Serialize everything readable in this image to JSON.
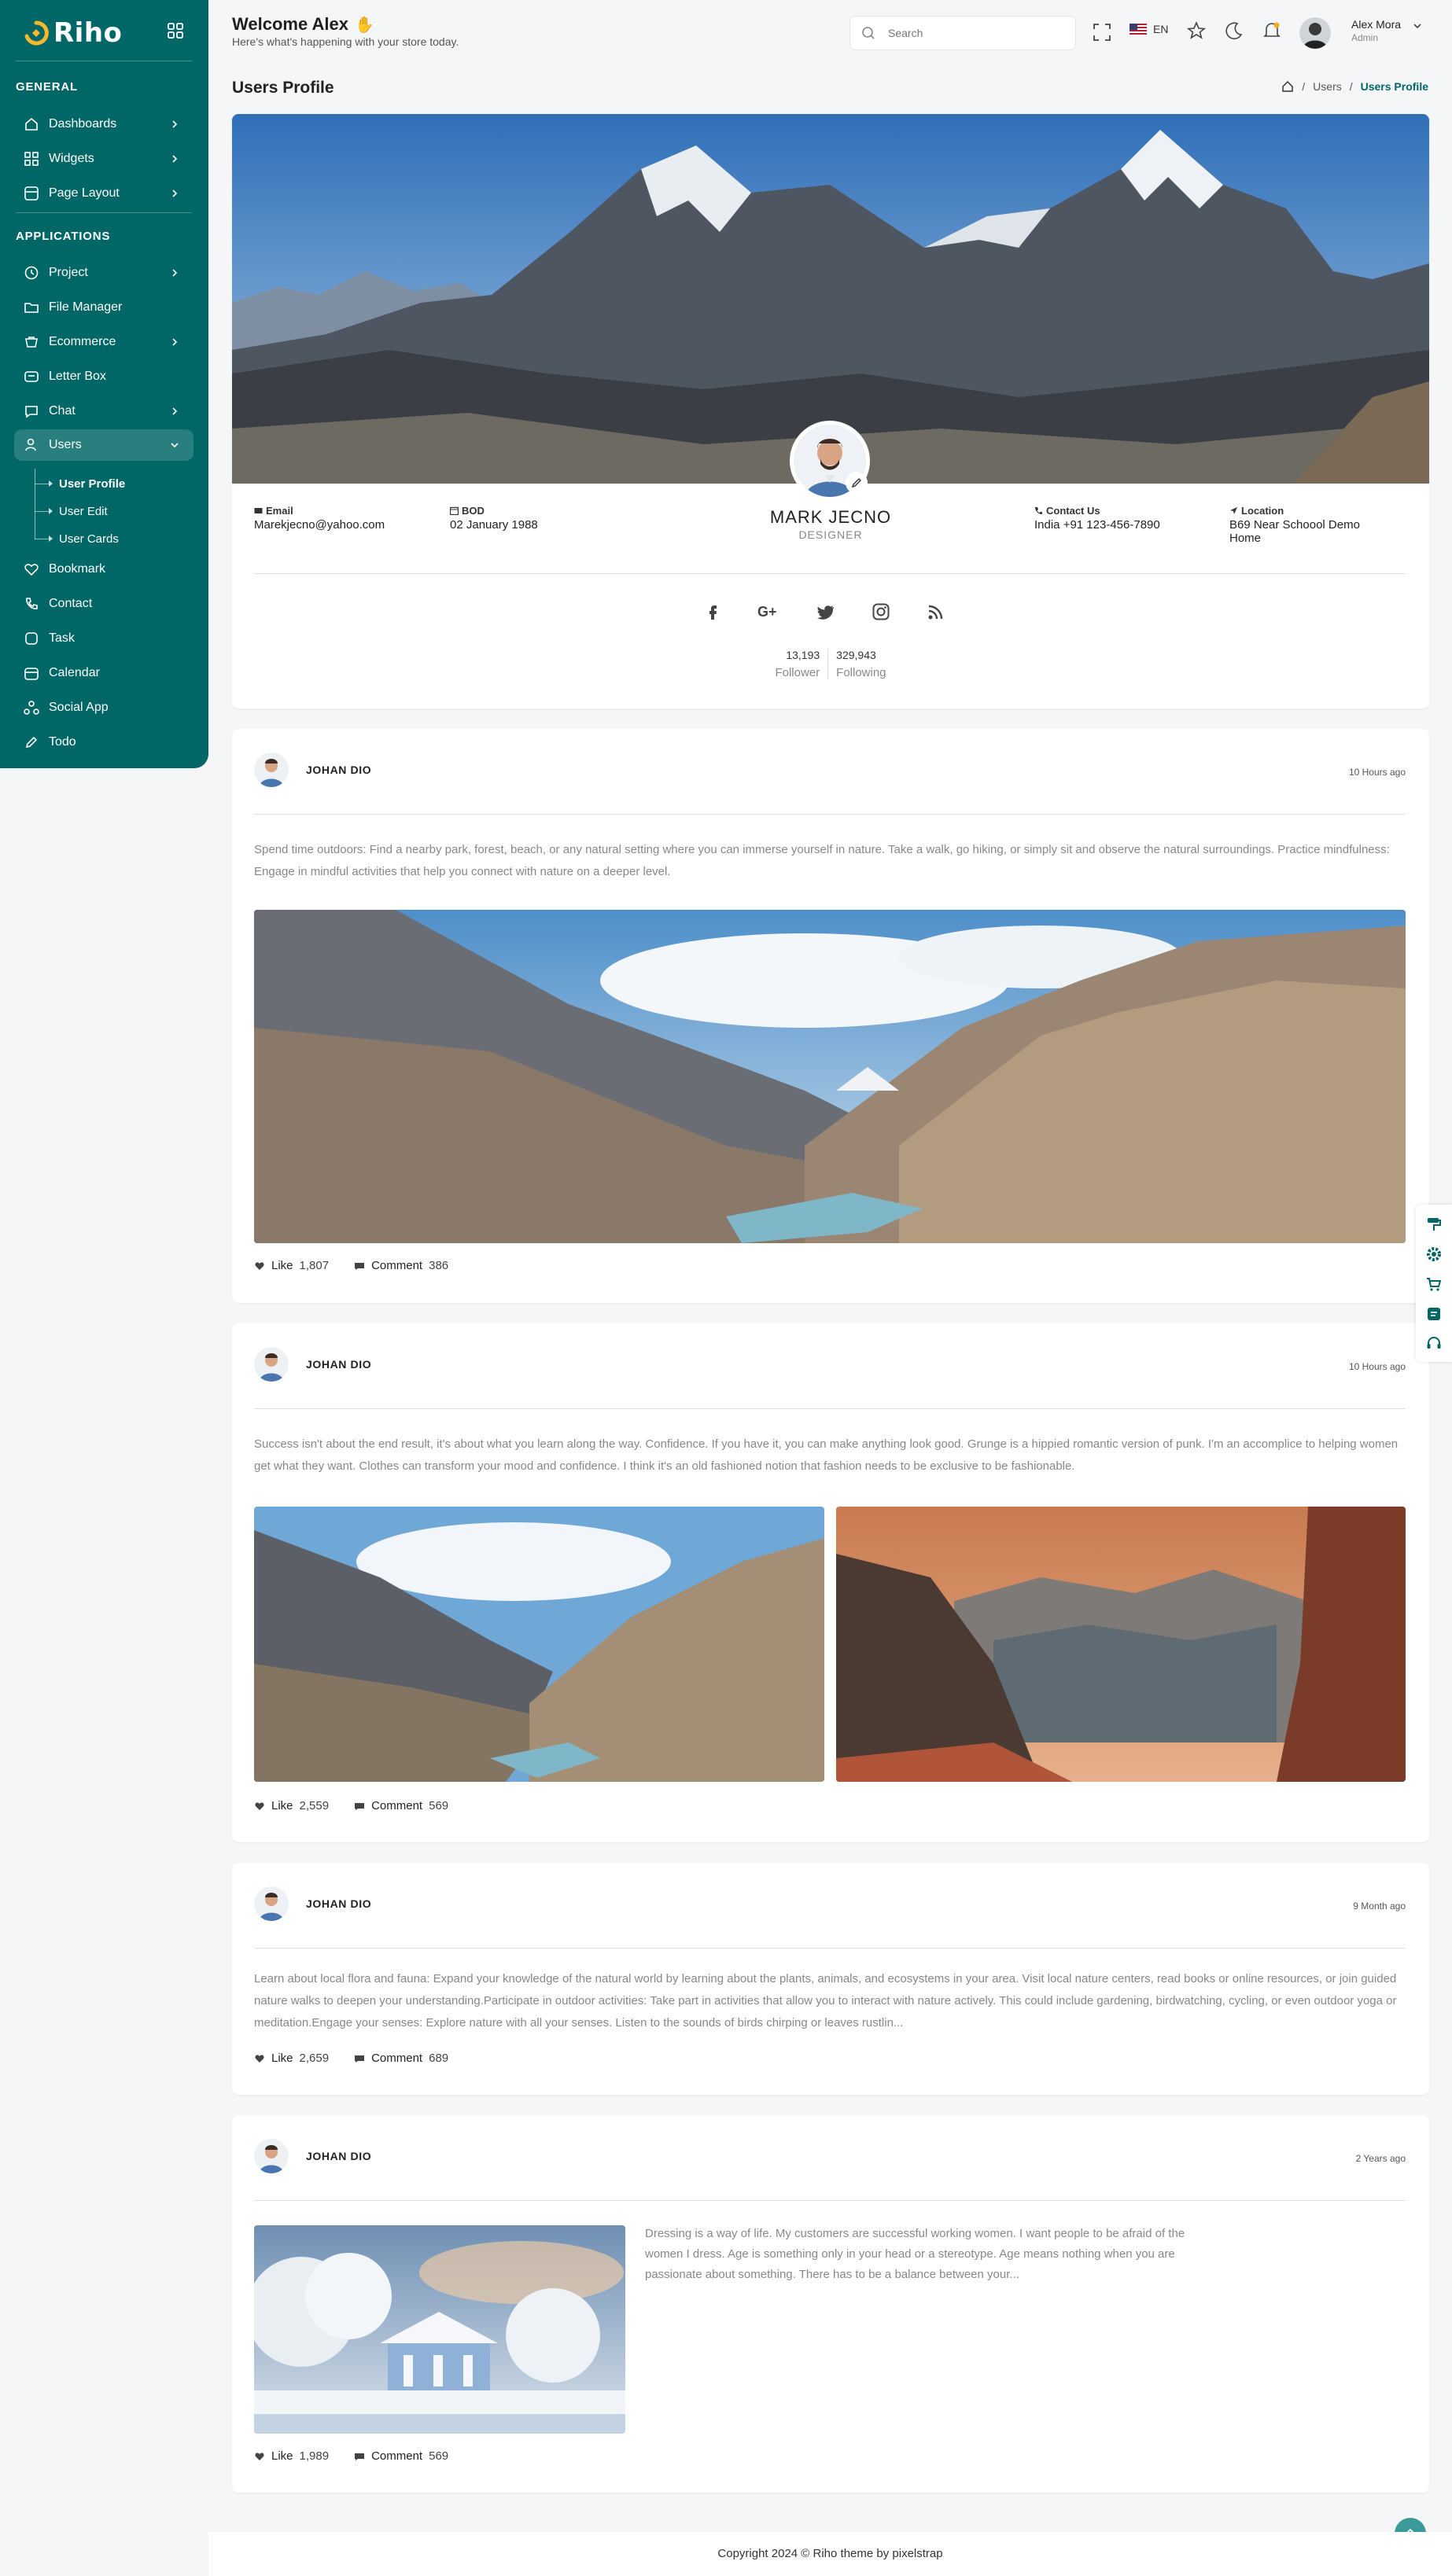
{
  "app": {
    "brand": "Riho"
  },
  "sidebar": {
    "sections": [
      "GENERAL",
      "APPLICATIONS"
    ],
    "general_items": [
      {
        "label": "Dashboards",
        "icon": "home-icon"
      },
      {
        "label": "Widgets",
        "icon": "widgets-icon"
      },
      {
        "label": "Page Layout",
        "icon": "layout-icon"
      }
    ],
    "app_items": [
      {
        "label": "Project",
        "icon": "project-icon"
      },
      {
        "label": "File Manager",
        "icon": "folder-icon"
      },
      {
        "label": "Ecommerce",
        "icon": "cart-icon"
      },
      {
        "label": "Letter Box",
        "icon": "mail-icon"
      },
      {
        "label": "Chat",
        "icon": "chat-icon"
      },
      {
        "label": "Users",
        "icon": "user-icon"
      },
      {
        "label": "Bookmark",
        "icon": "heart-icon"
      },
      {
        "label": "Contact",
        "icon": "phone-icon"
      },
      {
        "label": "Task",
        "icon": "task-icon"
      },
      {
        "label": "Calendar",
        "icon": "calendar-icon"
      },
      {
        "label": "Social App",
        "icon": "social-icon"
      },
      {
        "label": "Todo",
        "icon": "edit-icon"
      }
    ],
    "users_sub": [
      "User Profile",
      "User Edit",
      "User Cards"
    ]
  },
  "header": {
    "welcome": "Welcome Alex",
    "subtitle": "Here's what's happening with your store today.",
    "search_placeholder": "Search",
    "language": "EN",
    "user_name": "Alex Mora",
    "user_role": "Admin"
  },
  "page": {
    "title": "Users Profile",
    "breadcrumb": [
      "Users",
      "Users Profile"
    ]
  },
  "profile": {
    "name": "MARK JECNO",
    "role": "DESIGNER",
    "email_label": "Email",
    "email": "Marekjecno@yahoo.com",
    "bod_label": "BOD",
    "bod": "02 January 1988",
    "contact_label": "Contact Us",
    "contact": "India +91 123-456-7890",
    "location_label": "Location",
    "location": "B69 Near Schoool Demo Home",
    "followers": "13,193",
    "followers_label": "Follower",
    "following": "329,943",
    "following_label": "Following"
  },
  "posts": [
    {
      "author": "JOHAN DIO",
      "time": "10 Hours ago",
      "text": "Spend time outdoors: Find a nearby park, forest, beach, or any natural setting where you can immerse yourself in nature. Take a walk, go hiking, or simply sit and observe the natural surroundings. Practice mindfulness: Engage in mindful activities that help you connect with nature on a deeper level.",
      "like_label": "Like",
      "likes": "1,807",
      "comment_label": "Comment",
      "comments": "386"
    },
    {
      "author": "JOHAN DIO",
      "time": "10 Hours ago",
      "text": "Success isn't about the end result, it's about what you learn along the way. Confidence. If you have it, you can make anything look good. Grunge is a hippied romantic version of punk. I'm an accomplice to helping women get what they want. Clothes can transform your mood and confidence. I think it's an old fashioned notion that fashion needs to be exclusive to be fashionable.",
      "like_label": "Like",
      "likes": "2,559",
      "comment_label": "Comment",
      "comments": "569"
    },
    {
      "author": "JOHAN DIO",
      "time": "9 Month ago",
      "text": "Learn about local flora and fauna: Expand your knowledge of the natural world by learning about the plants, animals, and ecosystems in your area. Visit local nature centers, read books or online resources, or join guided nature walks to deepen your understanding.Participate in outdoor activities: Take part in activities that allow you to interact with nature actively. This could include gardening, birdwatching, cycling, or even outdoor yoga or meditation.Engage your senses: Explore nature with all your senses. Listen to the sounds of birds chirping or leaves rustlin...",
      "like_label": "Like",
      "likes": "2,659",
      "comment_label": "Comment",
      "comments": "689"
    },
    {
      "author": "JOHAN DIO",
      "time": "2 Years ago",
      "text": "Dressing is a way of life. My customers are successful working women. I want people to be afraid of the women I dress. Age is something only in your head or a stereotype. Age means nothing when you are passionate about something. There has to be a balance between your...",
      "like_label": "Like",
      "likes": "1,989",
      "comment_label": "Comment",
      "comments": "569"
    }
  ],
  "footer": {
    "text": "Copyright 2024 © Riho theme by pixelstrap"
  },
  "colors": {
    "primary": "#006666",
    "accent": "#f5a623",
    "sidebar": "#006666"
  }
}
